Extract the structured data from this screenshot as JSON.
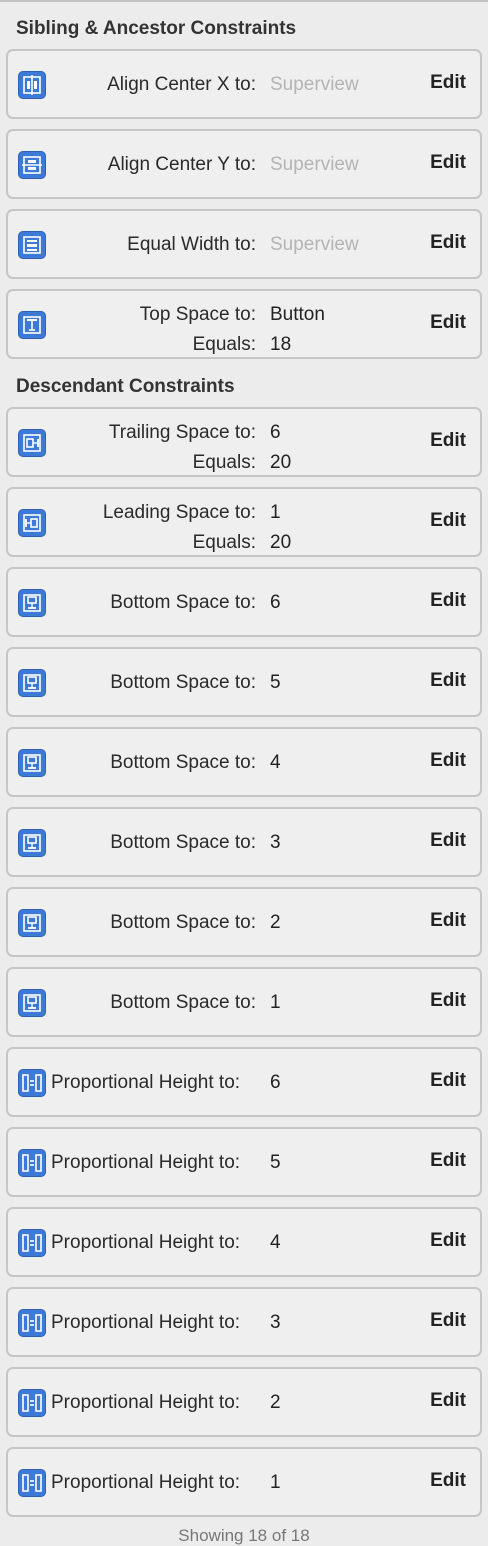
{
  "sections": {
    "sibling_ancestor": "Sibling & Ancestor Constraints",
    "descendant": "Descendant Constraints"
  },
  "edit_label": "Edit",
  "footer": "Showing 18 of 18",
  "accent_color": "#3d7ad8",
  "constraints": [
    {
      "icon": "align-center-x-icon",
      "label": "Align Center X to:",
      "value": "Superview",
      "placeholder": true
    },
    {
      "icon": "align-center-y-icon",
      "label": "Align Center Y to:",
      "value": "Superview",
      "placeholder": true
    },
    {
      "icon": "equal-width-icon",
      "label": "Equal Width to:",
      "value": "Superview",
      "placeholder": true
    },
    {
      "icon": "top-space-icon",
      "label": "Top Space to:",
      "value": "Button",
      "label2": "Equals:",
      "value2": "18"
    },
    {
      "icon": "trailing-space-icon",
      "label": "Trailing Space to:",
      "value": "6",
      "label2": "Equals:",
      "value2": "20"
    },
    {
      "icon": "leading-space-icon",
      "label": "Leading Space to:",
      "value": "1",
      "label2": "Equals:",
      "value2": "20"
    },
    {
      "icon": "bottom-space-icon",
      "label": "Bottom Space to:",
      "value": "6"
    },
    {
      "icon": "bottom-space-icon",
      "label": "Bottom Space to:",
      "value": "5"
    },
    {
      "icon": "bottom-space-icon",
      "label": "Bottom Space to:",
      "value": "4"
    },
    {
      "icon": "bottom-space-icon",
      "label": "Bottom Space to:",
      "value": "3"
    },
    {
      "icon": "bottom-space-icon",
      "label": "Bottom Space to:",
      "value": "2"
    },
    {
      "icon": "bottom-space-icon",
      "label": "Bottom Space to:",
      "value": "1"
    },
    {
      "icon": "proportional-height-icon",
      "label": "Proportional Height to:",
      "value": "6"
    },
    {
      "icon": "proportional-height-icon",
      "label": "Proportional Height to:",
      "value": "5"
    },
    {
      "icon": "proportional-height-icon",
      "label": "Proportional Height to:",
      "value": "4"
    },
    {
      "icon": "proportional-height-icon",
      "label": "Proportional Height to:",
      "value": "3"
    },
    {
      "icon": "proportional-height-icon",
      "label": "Proportional Height to:",
      "value": "2"
    },
    {
      "icon": "proportional-height-icon",
      "label": "Proportional Height to:",
      "value": "1"
    }
  ]
}
